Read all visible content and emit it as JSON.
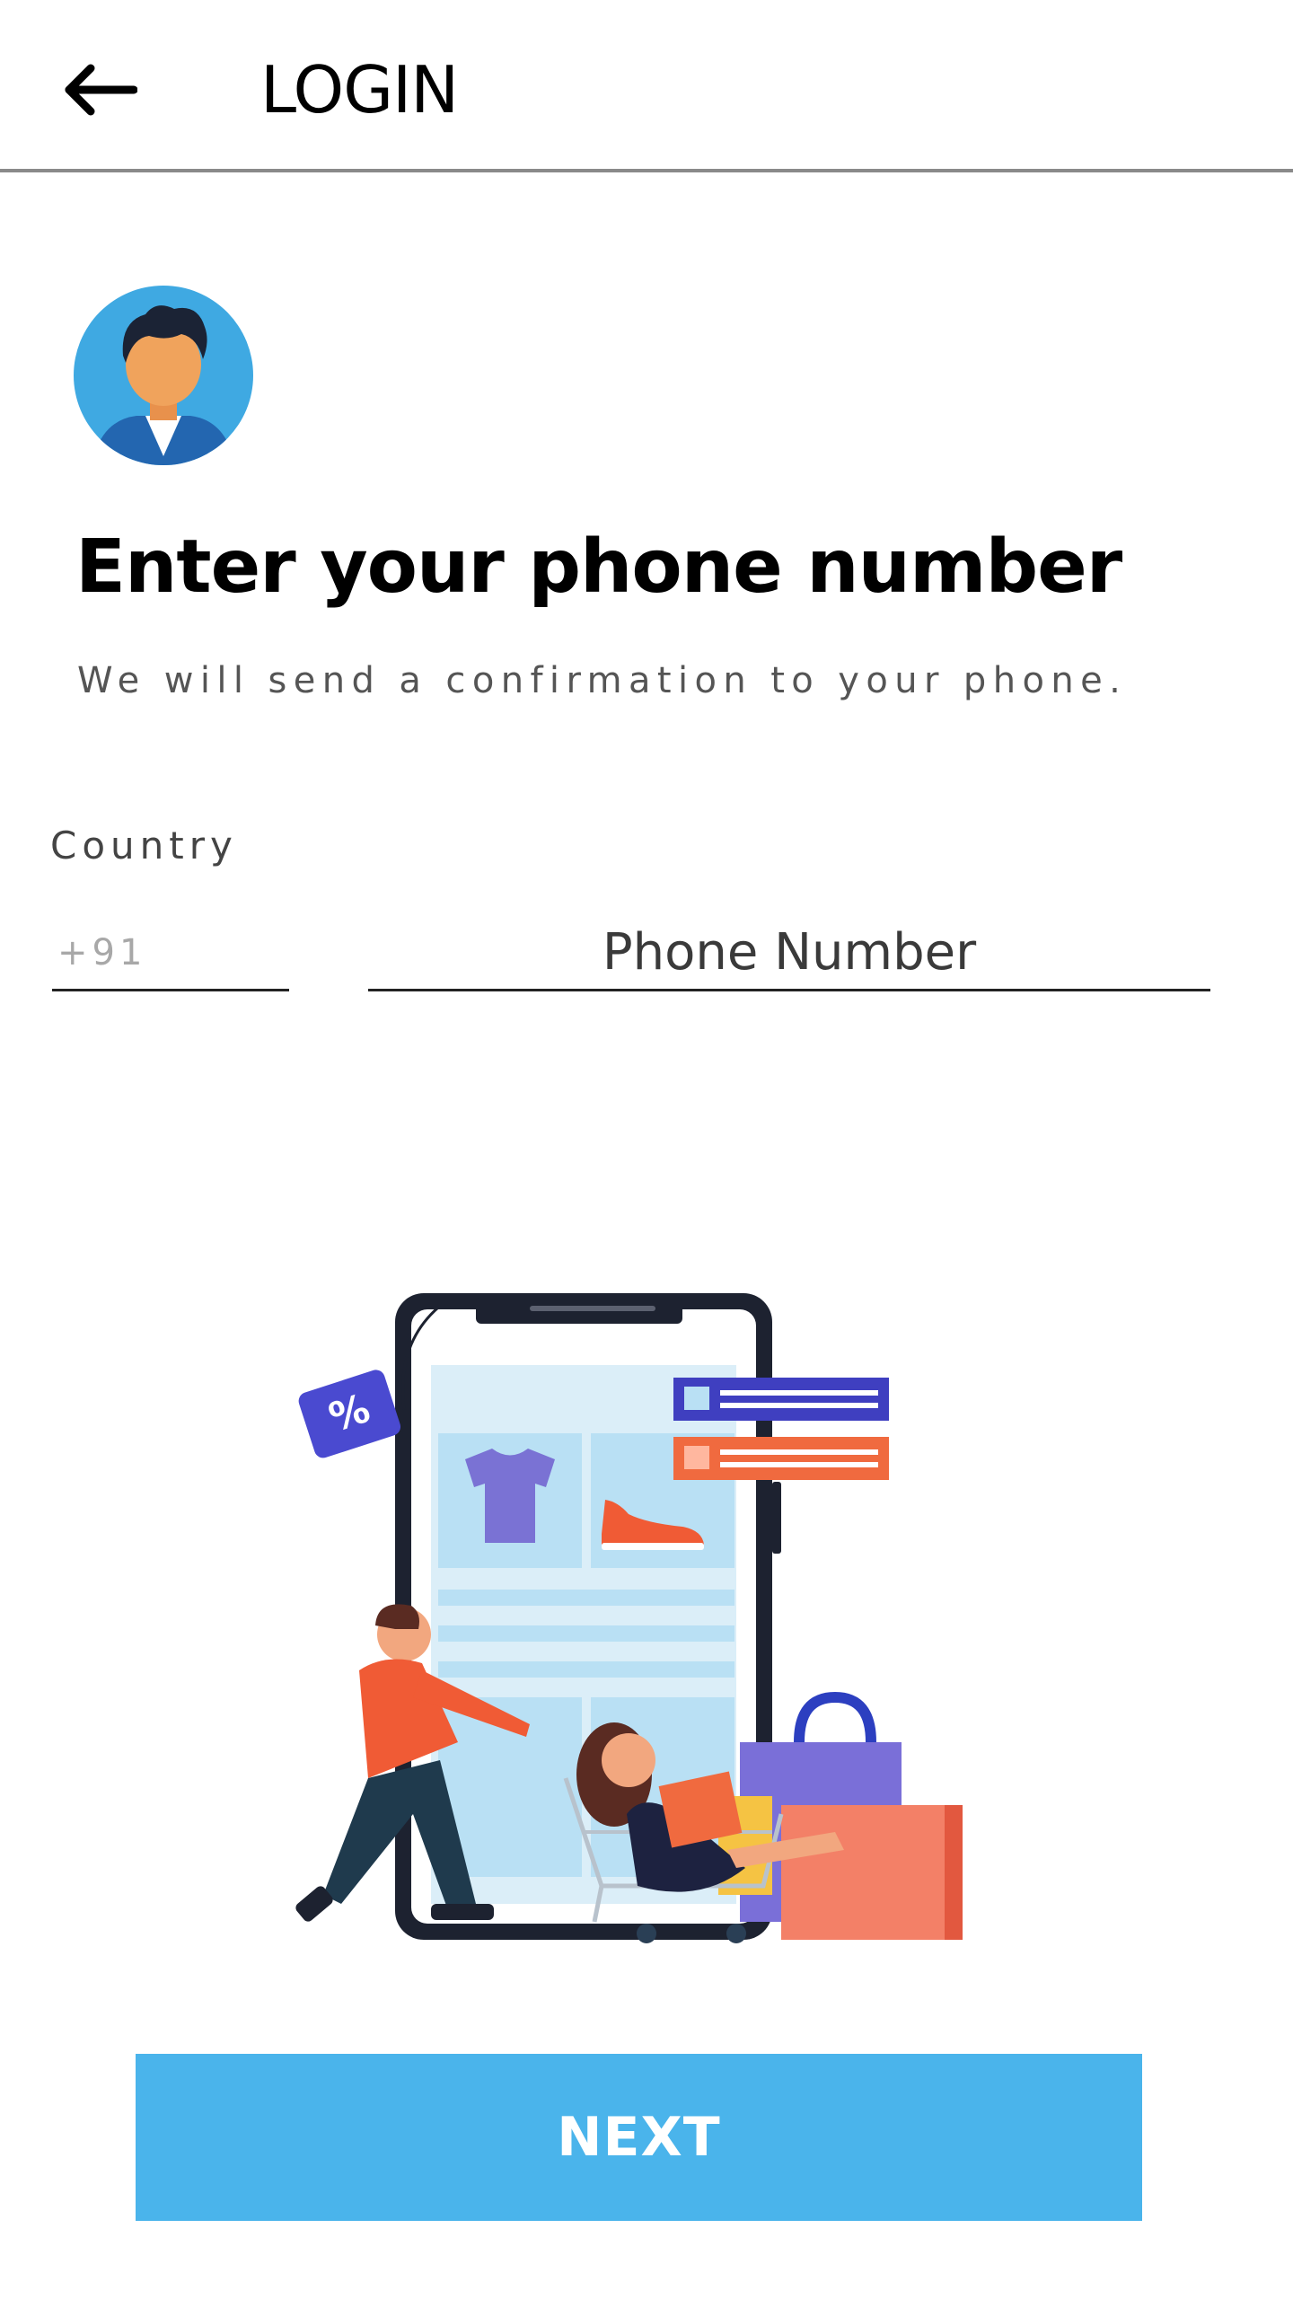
{
  "header": {
    "title": "LOGIN",
    "back_icon": "arrow-left-icon"
  },
  "avatar": {
    "icon": "user-avatar-icon"
  },
  "main": {
    "heading": "Enter your phone number",
    "subheading": "We will send a confirmation to your phone."
  },
  "form": {
    "country_label": "Country",
    "country_code_placeholder": "+91",
    "phone_placeholder": "Phone Number"
  },
  "illustration": {
    "icon": "online-shopping-illustration",
    "discount_tag": "%"
  },
  "actions": {
    "next_label": "NEXT"
  },
  "colors": {
    "accent": "#4ab4eb",
    "avatar_bg": "#3fa9e2",
    "divider": "#8a8a8a"
  }
}
